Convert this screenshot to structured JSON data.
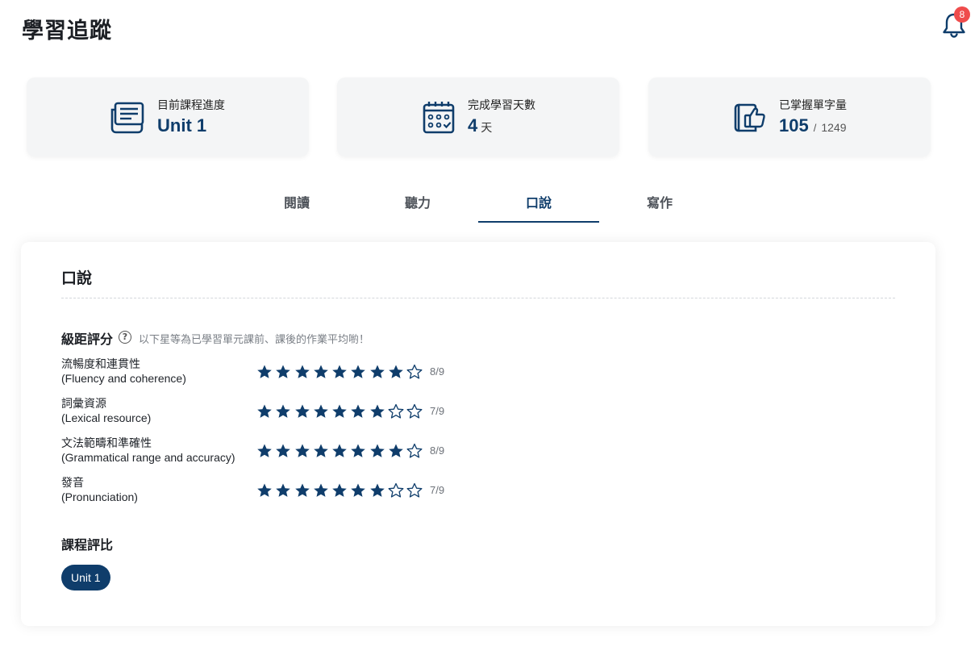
{
  "header": {
    "title": "學習追蹤",
    "notification_count": "8"
  },
  "stats": [
    {
      "label": "目前課程進度",
      "value": "Unit 1",
      "icon": "course-book-icon"
    },
    {
      "label": "完成學習天數",
      "value": "4",
      "unit": "天",
      "icon": "calendar-icon"
    },
    {
      "label": "已掌握單字量",
      "value": "105",
      "sep": "/",
      "total": "1249",
      "icon": "vocab-thumbs-up-icon"
    }
  ],
  "tabs": [
    {
      "label": "閱讀",
      "active": false
    },
    {
      "label": "聽力",
      "active": false
    },
    {
      "label": "口說",
      "active": true
    },
    {
      "label": "寫作",
      "active": false
    }
  ],
  "panel": {
    "title": "口說",
    "grade_title": "級距評分",
    "grade_hint": "以下星等為已學習單元課前、課後的作業平均喲！",
    "criteria": [
      {
        "cn": "流暢度和連貫性",
        "en": "(Fluency and coherence)",
        "score": 8,
        "max": 9,
        "score_text": "8/9"
      },
      {
        "cn": "詞彙資源",
        "en": "(Lexical resource)",
        "score": 7,
        "max": 9,
        "score_text": "7/9"
      },
      {
        "cn": "文法範疇和準確性",
        "en": "(Grammatical range and accuracy)",
        "score": 8,
        "max": 9,
        "score_text": "8/9"
      },
      {
        "cn": "發音",
        "en": "(Pronunciation)",
        "score": 7,
        "max": 9,
        "score_text": "7/9"
      }
    ],
    "course_title": "課程評比",
    "course_units": [
      "Unit 1"
    ]
  },
  "colors": {
    "primary": "#0f3d6b",
    "badge": "#ef4c4c",
    "card_bg": "#f4f5f6"
  }
}
